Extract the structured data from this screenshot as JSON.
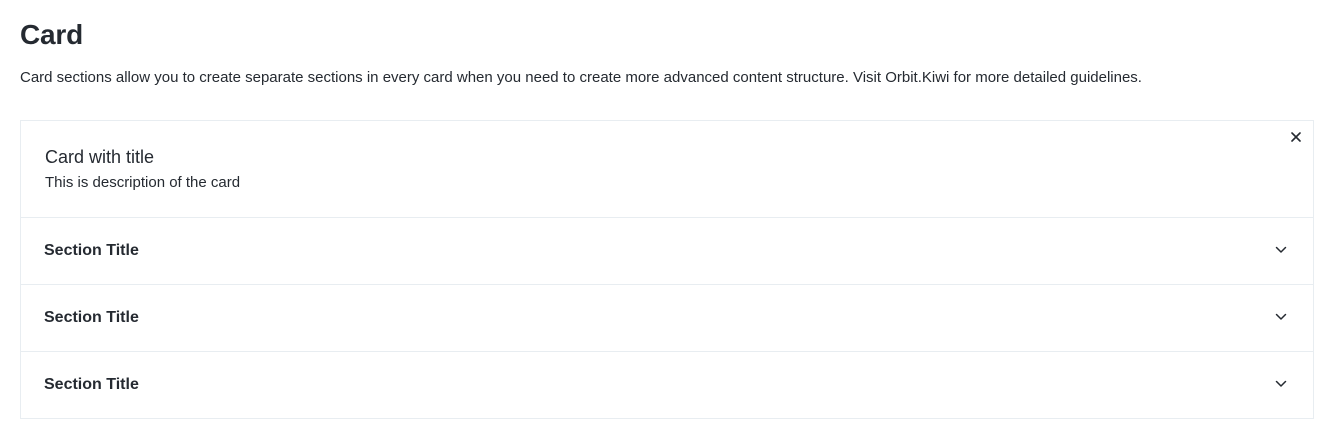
{
  "page": {
    "title": "Card",
    "description": "Card sections allow you to create separate sections in every card when you need to create more advanced content structure. Visit Orbit.Kiwi for more detailed guidelines."
  },
  "card": {
    "title": "Card with title",
    "description": "This is description of the card",
    "close_icon": "close-icon",
    "sections": [
      {
        "title": "Section Title",
        "icon": "chevron-down-icon"
      },
      {
        "title": "Section Title",
        "icon": "chevron-down-icon"
      },
      {
        "title": "Section Title",
        "icon": "chevron-down-icon"
      }
    ]
  },
  "colors": {
    "text": "#252a31",
    "border": "#e8edf1",
    "background": "#ffffff"
  }
}
